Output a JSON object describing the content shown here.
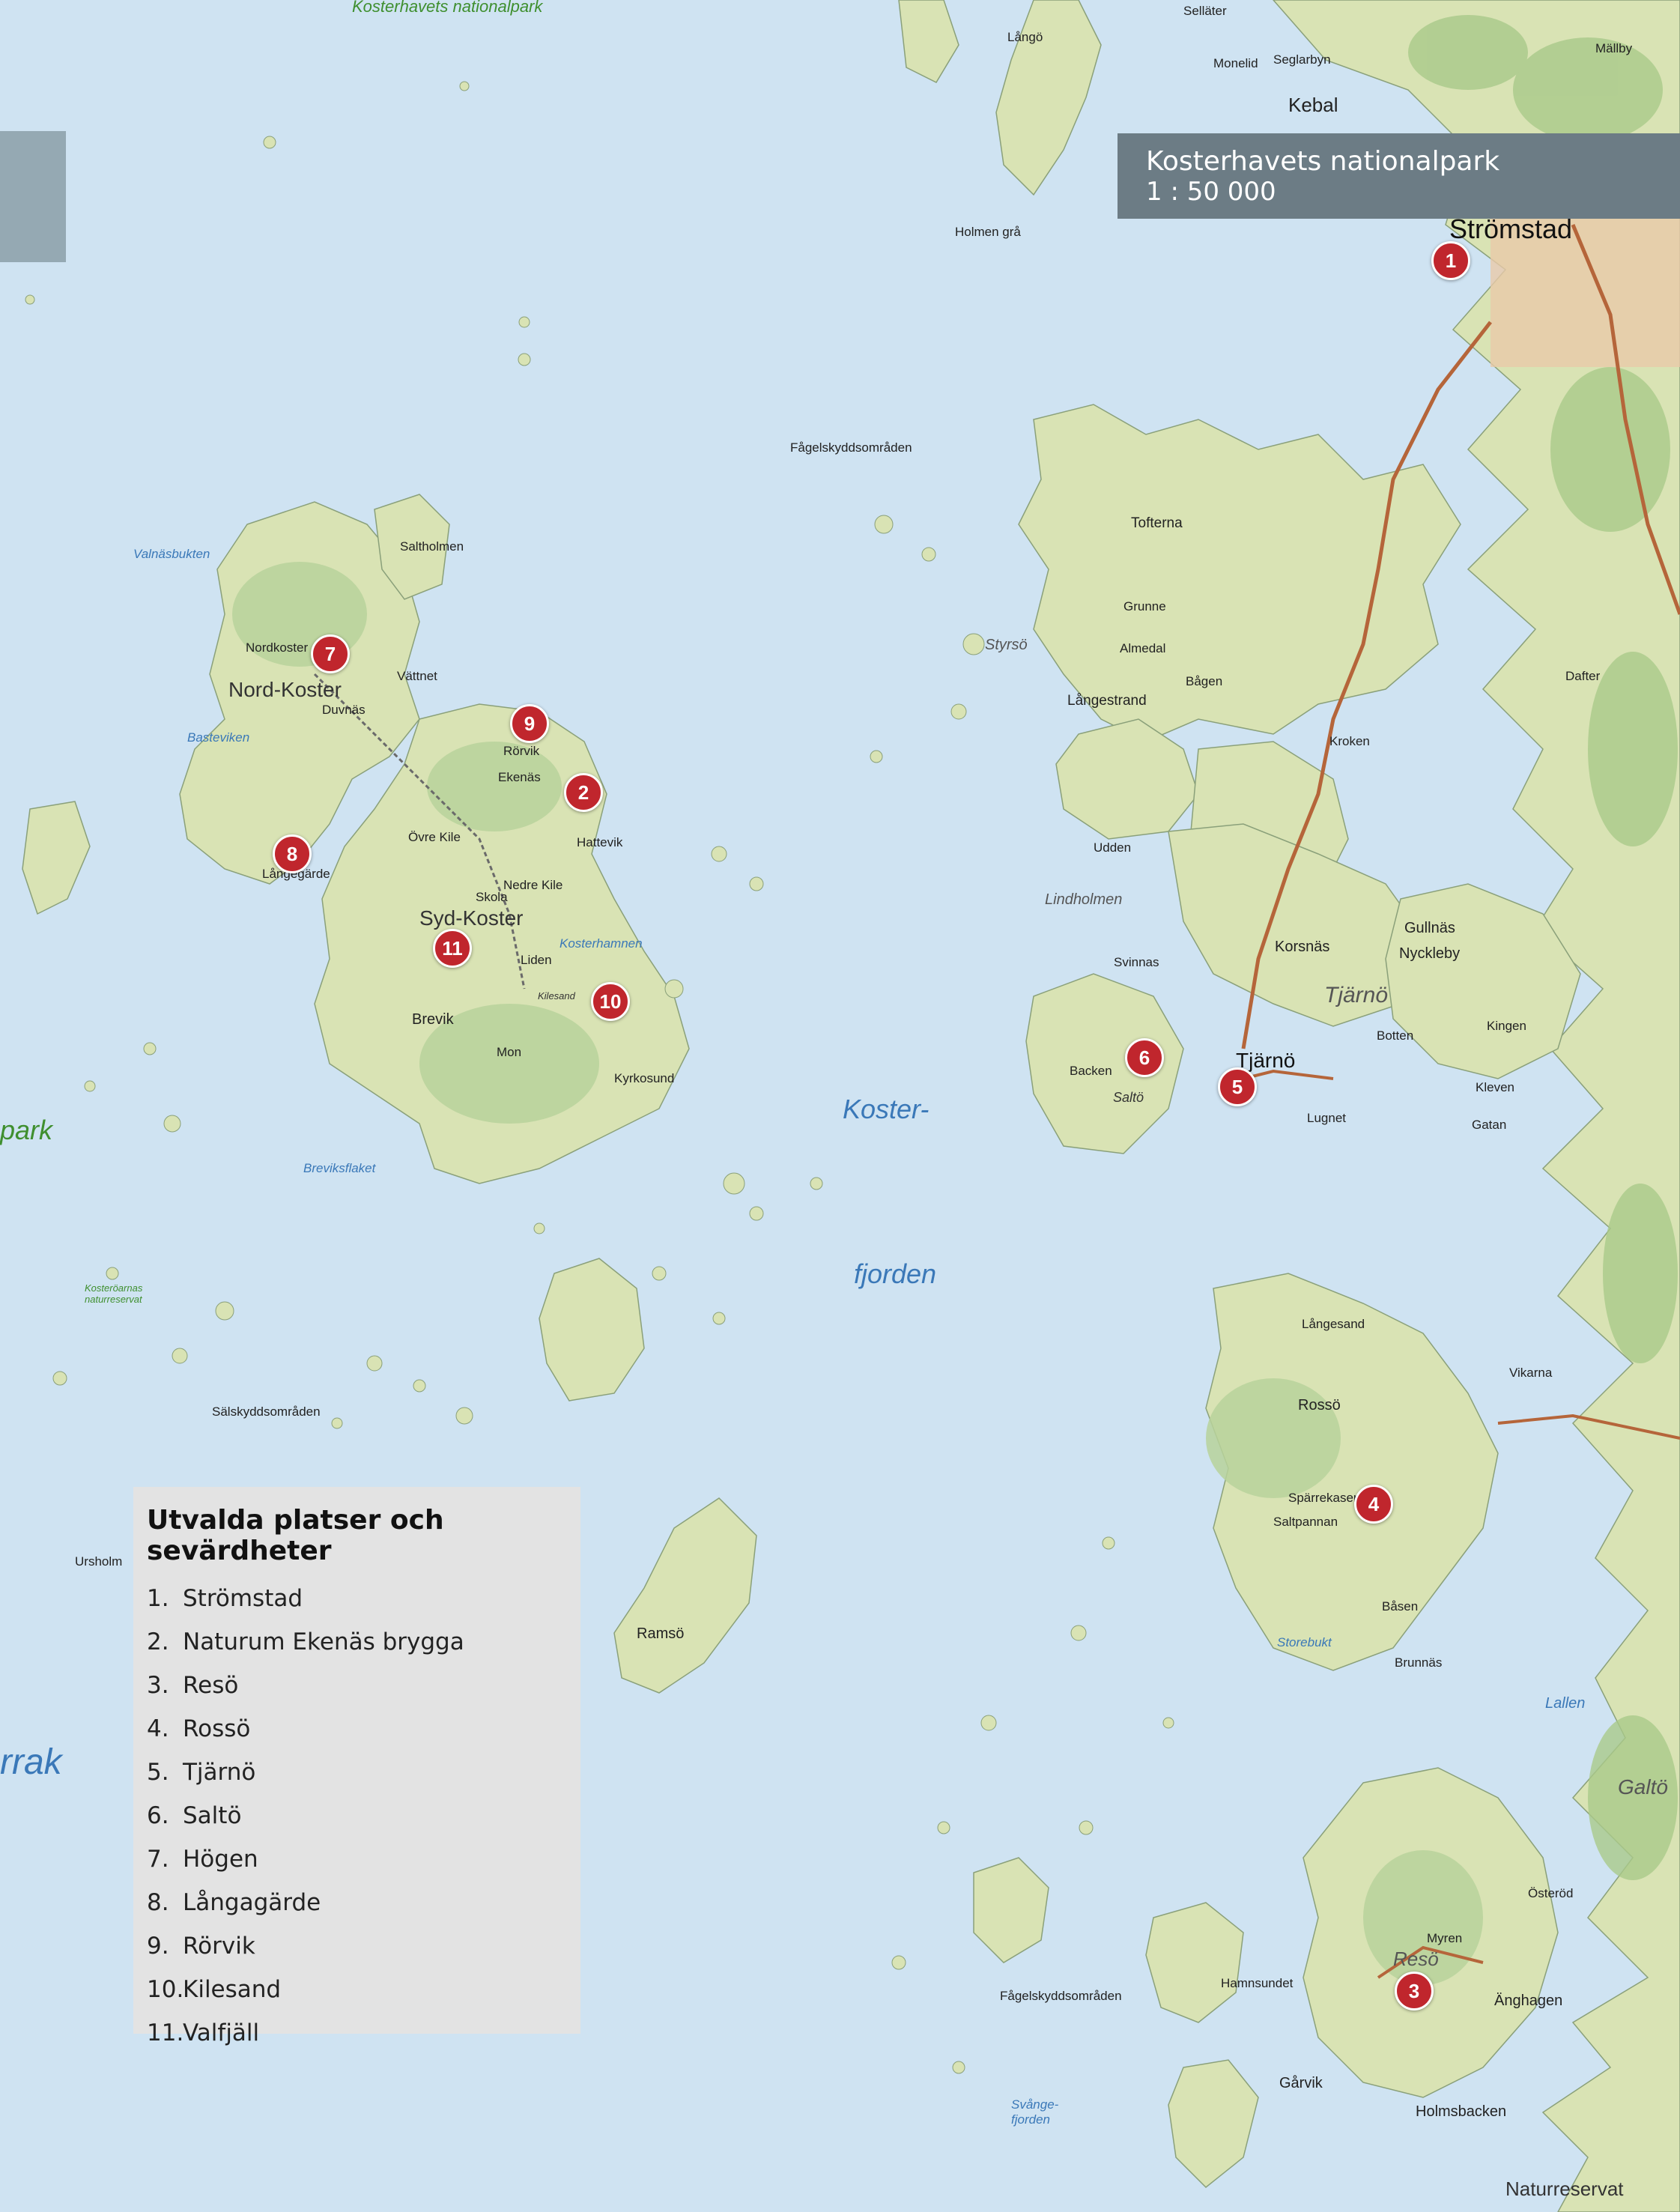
{
  "title": {
    "name": "Kosterhavets nationalpark",
    "scale": "1 : 50 000"
  },
  "legend": {
    "heading": "Utvalda platser och sevärdheter",
    "items": [
      {
        "num": "1.",
        "name": "Strömstad"
      },
      {
        "num": "2.",
        "name": "Naturum Ekenäs brygga"
      },
      {
        "num": "3.",
        "name": "Resö"
      },
      {
        "num": "4.",
        "name": "Rossö"
      },
      {
        "num": "5.",
        "name": "Tjärnö"
      },
      {
        "num": "6.",
        "name": "Saltö"
      },
      {
        "num": "7.",
        "name": "Högen"
      },
      {
        "num": "8.",
        "name": "Långagärde"
      },
      {
        "num": "9.",
        "name": "Rörvik"
      },
      {
        "num": "10.",
        "name": "Kilesand"
      },
      {
        "num": "11.",
        "name": "Valfjäll"
      }
    ]
  },
  "markers": [
    "1",
    "2",
    "3",
    "4",
    "5",
    "6",
    "7",
    "8",
    "9",
    "10",
    "11"
  ],
  "labels": {
    "park_top": "Kosterhavets nationalpark",
    "park_left": "park",
    "rrak": "rrak",
    "kosterfjorden_1": "Koster-",
    "kosterfjorden_2": "fjorden",
    "stromstad": "Strömstad",
    "kebal": "Kebal",
    "nord_koster": "Nord-Koster",
    "syd_koster": "Syd-Koster",
    "nordkoster": "Nordkoster",
    "vattnet": "Vättnet",
    "duvnas": "Duvnäs",
    "rorvik": "Rörvik",
    "ekenas": "Ekenäs",
    "hattevik": "Hattevik",
    "langegarde": "Långegärde",
    "ovre_kile": "Övre Kile",
    "nedre_kile": "Nedre Kile",
    "skola": "Skola",
    "liden": "Liden",
    "brevik": "Brevik",
    "mon": "Mon",
    "kyrkosund": "Kyrkosund",
    "kilesand": "Kilesand",
    "ramso": "Ramsö",
    "tjarno": "Tjärnö",
    "tjarno_big": "Tjärnö",
    "salto": "Saltö",
    "rosso": "Rossö",
    "reso": "Resö",
    "galto": "Galtö",
    "korsnas": "Korsnäs",
    "gullnas": "Gullnäs",
    "nyckleby": "Nyckleby",
    "tofterna": "Tofterna",
    "almedal": "Almedal",
    "langestrand": "Långestrand",
    "bagen": "Bågen",
    "grunne": "Grunne",
    "kroken": "Kroken",
    "udden": "Udden",
    "svinnas": "Svinnas",
    "backen": "Backen",
    "lindholmen": "Lindholmen",
    "langesand": "Långesand",
    "vikarna": "Vikarna",
    "sparrekasen": "Spärrekasen",
    "saltpannan": "Saltpannan",
    "basen": "Båsen",
    "brunnas": "Brunnäs",
    "myren": "Myren",
    "osterod": "Österöd",
    "anghagen": "Änghagen",
    "holmsbacken": "Holmsbacken",
    "garvik": "Gårvik",
    "hamnsundet": "Hamnsundet",
    "styrso": "Styrsö",
    "dafter": "Dafter",
    "kingen": "Kingen",
    "botten": "Botten",
    "lugnet": "Lugnet",
    "kleven": "Kleven",
    "gatan": "Gatan",
    "fagelskydd1": "Fågelskyddsområden",
    "fagelskydd2": "Fågelskyddsområden",
    "salskydd": "Sälskyddsområden",
    "kosteroarnas_nr": "Kosteröarnas naturreservat",
    "saltholmen": "Saltholmen",
    "basteviken": "Basteviken",
    "valnasbukten": "Valnäsbukten",
    "breviksflaket": "Breviksflaket",
    "storebukt": "Storebukt",
    "lallen": "Lallen",
    "svangefjorden": "Svånge-fjorden",
    "kosterhamnen": "Kosterhamnen",
    "seglarbyn": "Seglarbyn",
    "monelid": "Monelid",
    "mallby": "Mällby",
    "sellater": "Selläter",
    "holmen_gra": "Holmen grå",
    "langgo": "Långö",
    "ursholm": "Ursholm",
    "naturreservat_bottom": "Naturreservat"
  }
}
